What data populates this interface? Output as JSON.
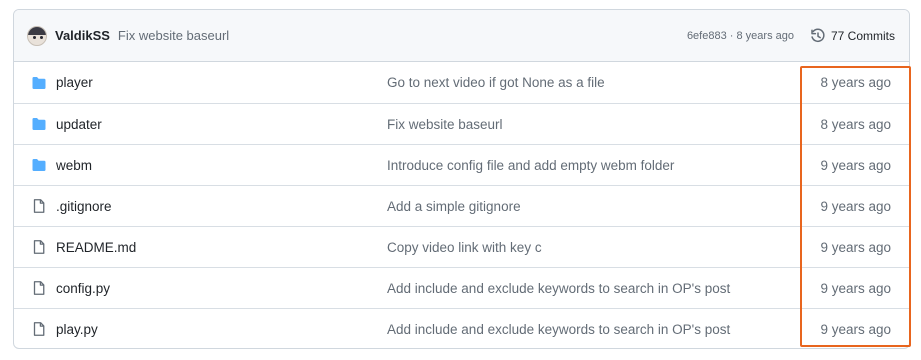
{
  "header": {
    "author": "ValdikSS",
    "commit_message": "Fix website baseurl",
    "sha": "6efe883",
    "separator": "·",
    "age": "8 years ago",
    "commits_label": "77 Commits",
    "avatar_icon": "user-avatar",
    "history_icon": "history-icon"
  },
  "files": [
    {
      "type": "folder",
      "icon": "folder-icon",
      "name": "player",
      "message": "Go to next video if got None as a file",
      "age": "8 years ago"
    },
    {
      "type": "folder",
      "icon": "folder-icon",
      "name": "updater",
      "message": "Fix website baseurl",
      "age": "8 years ago"
    },
    {
      "type": "folder",
      "icon": "folder-icon",
      "name": "webm",
      "message": "Introduce config file and add empty webm folder",
      "age": "9 years ago"
    },
    {
      "type": "file",
      "icon": "file-icon",
      "name": ".gitignore",
      "message": "Add a simple gitignore",
      "age": "9 years ago"
    },
    {
      "type": "file",
      "icon": "file-icon",
      "name": "README.md",
      "message": "Copy video link with key c",
      "age": "9 years ago"
    },
    {
      "type": "file",
      "icon": "file-icon",
      "name": "config.py",
      "message": "Add include and exclude keywords to search in OP's post",
      "age": "9 years ago"
    },
    {
      "type": "file",
      "icon": "file-icon",
      "name": "play.py",
      "message": "Add include and exclude keywords to search in OP's post",
      "age": "9 years ago"
    }
  ],
  "colors": {
    "folder": "#54aeff",
    "file": "#636c76",
    "highlight": "#e8651e"
  }
}
